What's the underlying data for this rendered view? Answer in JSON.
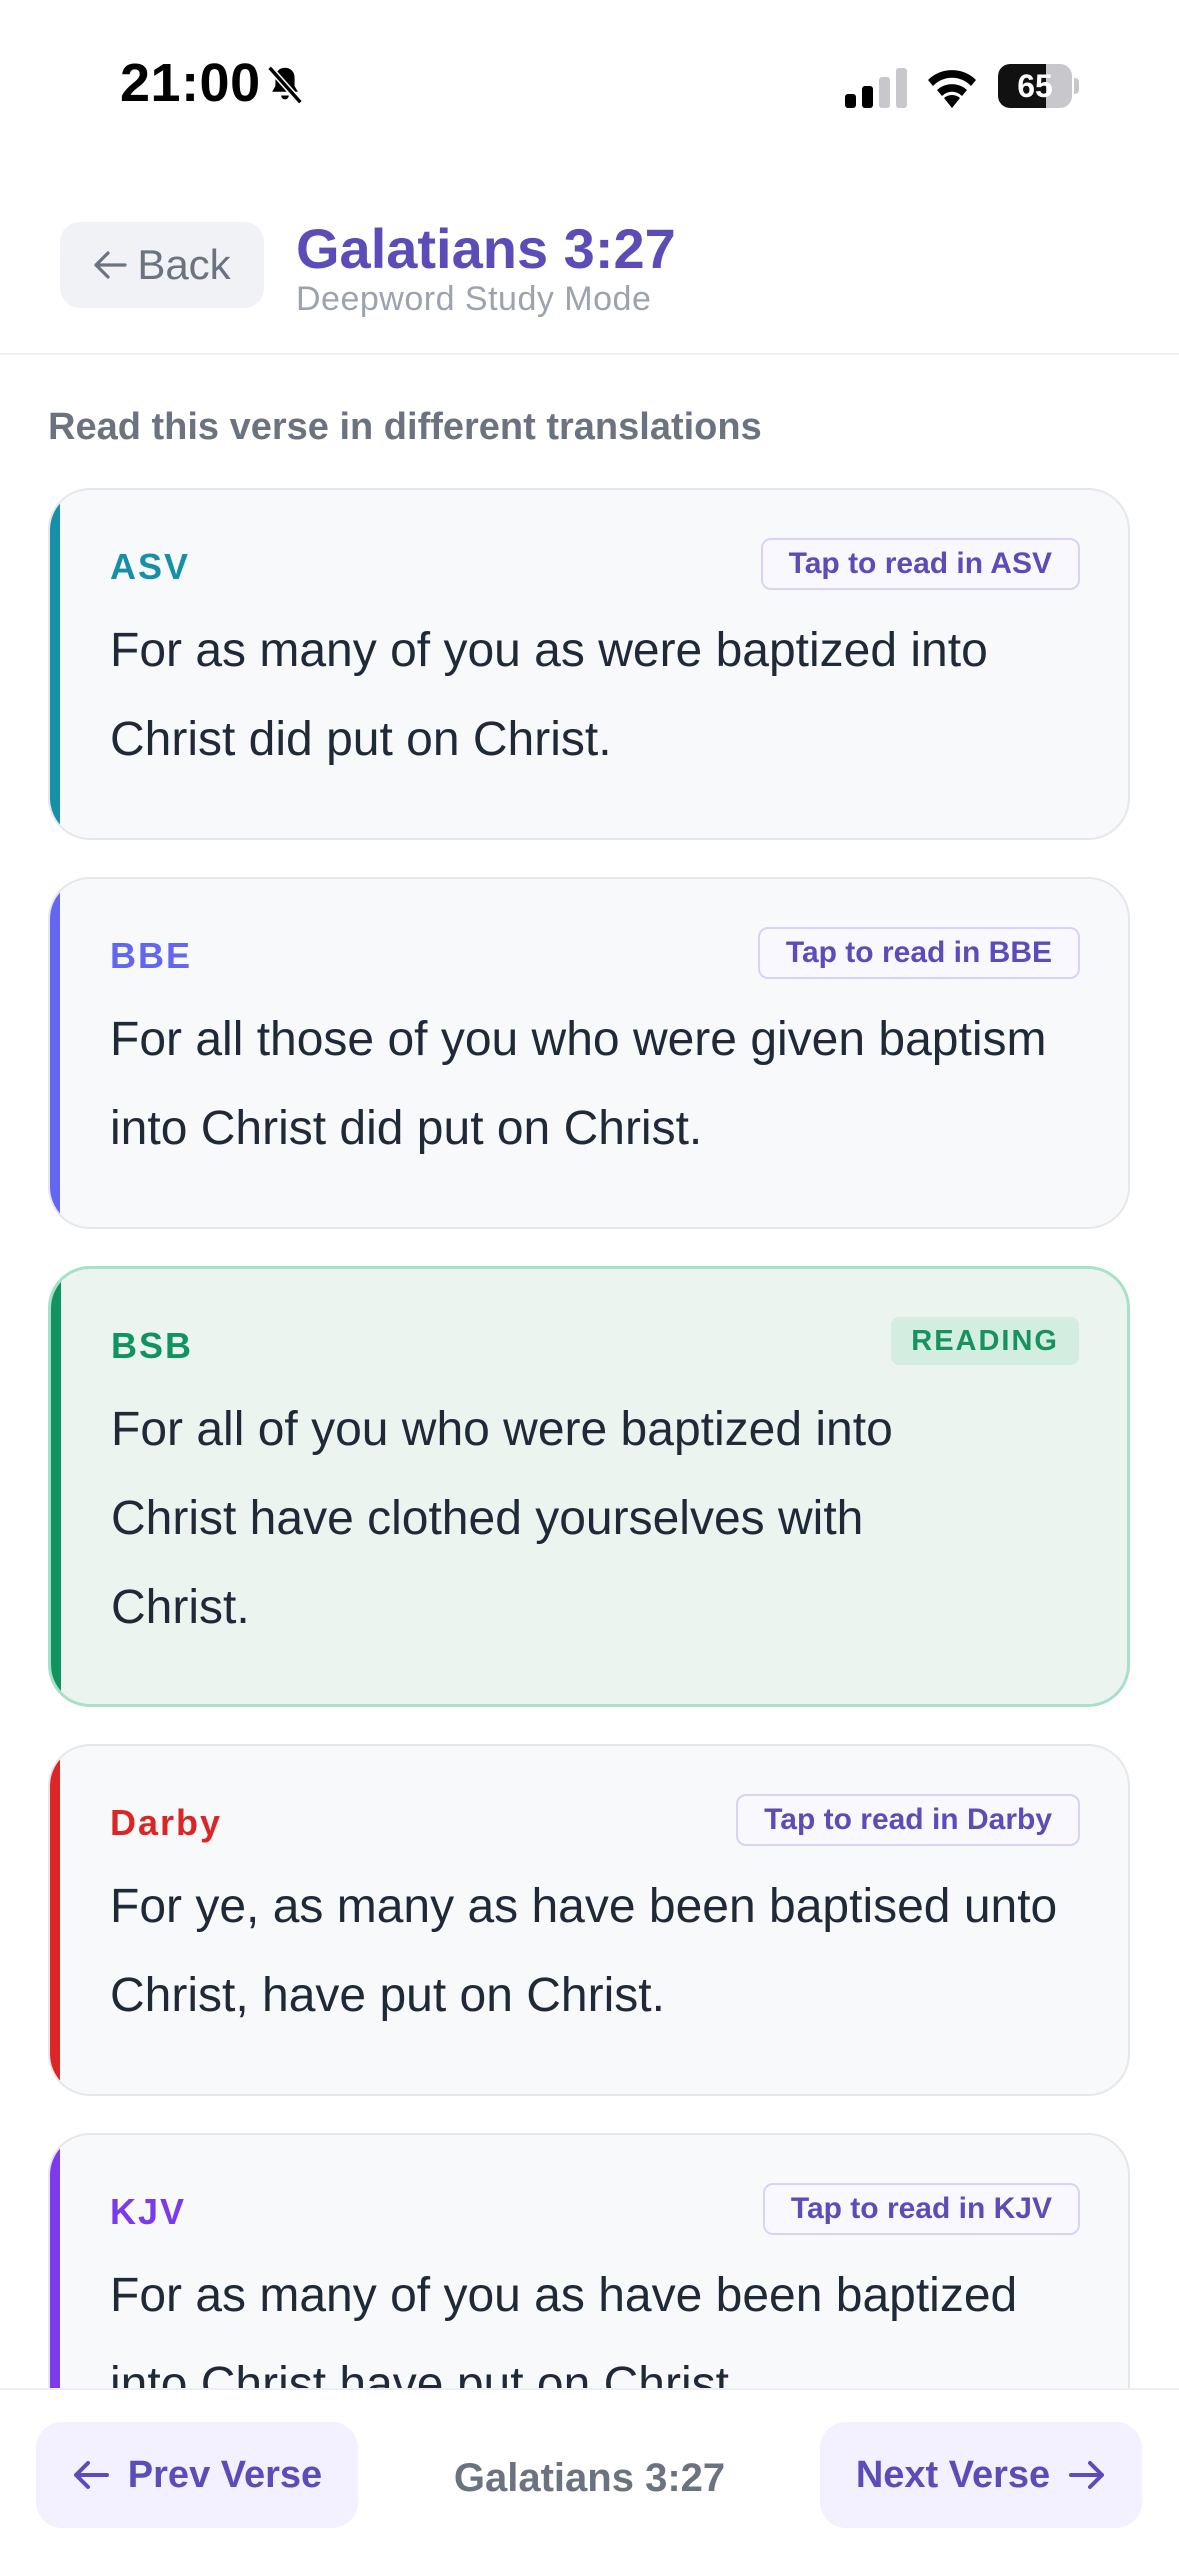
{
  "status_bar": {
    "time": "21:00",
    "battery_level": "65",
    "battery_fraction": 0.65,
    "icons": [
      "bell-muted-icon",
      "signal-icon",
      "wifi-icon",
      "battery-icon"
    ]
  },
  "header": {
    "back_label": "Back",
    "title": "Galatians 3:27",
    "subtitle": "Deepword Study Mode"
  },
  "section_heading": "Read this verse in different translations",
  "translations": [
    {
      "code": "ASV",
      "badge": "Tap to read in ASV",
      "text": "For as many of you as were baptized into Christ did put on Christ.",
      "accent": "#1590a8",
      "active": false
    },
    {
      "code": "BBE",
      "badge": "Tap to read in BBE",
      "text": "For all those of you who were given baptism into Christ did put on Christ.",
      "accent": "#6366f1",
      "active": false
    },
    {
      "code": "BSB",
      "badge": "READING",
      "text": "For all of you who were baptized into Christ have clothed yourselves with Christ.",
      "accent": "#0f9460",
      "active": true
    },
    {
      "code": "Darby",
      "badge": "Tap to read in Darby",
      "text": "For ye, as many as have been baptised unto Christ, have put on Christ.",
      "accent": "#dc2626",
      "active": false
    },
    {
      "code": "KJV",
      "badge": "Tap to read in KJV",
      "text": "For as many of you as have been baptized into Christ have put on Christ.",
      "accent": "#7c3aed",
      "active": false
    }
  ],
  "bottom_nav": {
    "prev_label": "Prev Verse",
    "current_ref": "Galatians 3:27",
    "next_label": "Next Verse"
  },
  "colors": {
    "brand": "#5b4cb8",
    "reading_green": "#16925f"
  }
}
